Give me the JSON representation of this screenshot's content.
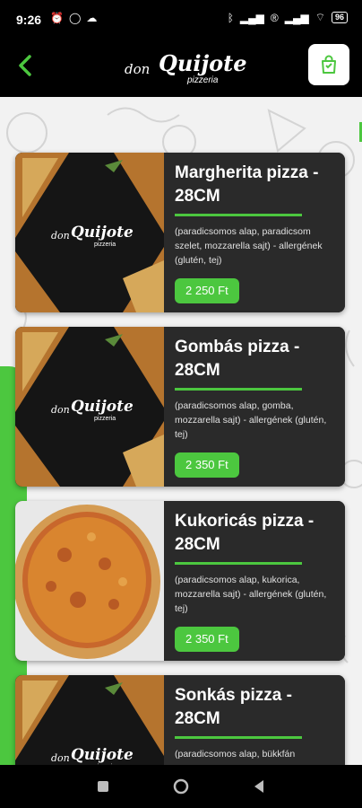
{
  "status_bar": {
    "time": "9:26",
    "battery": "96",
    "left_icons": [
      "alarm-icon",
      "circle-icon",
      "cloud-icon"
    ],
    "right_icons": [
      "bluetooth-icon",
      "signal-icon",
      "registered-icon",
      "signal-icon",
      "wifi-icon",
      "battery-icon"
    ]
  },
  "app_bar": {
    "logo_don": "don",
    "logo_quijote": "Quijote",
    "logo_pizzeria": "pizzeria",
    "back_icon": "chevron-left-icon",
    "cart_icon": "shopping-bag-icon"
  },
  "products": [
    {
      "title": "Margherita pizza - 28CM",
      "description": "(paradicsomos alap, paradicsom szelet, mozzarella sajt) - allergének (glutén, tej)",
      "price": "2 250 Ft",
      "image": "logo-pizza"
    },
    {
      "title": "Gombás pizza - 28CM",
      "description": "(paradicsomos alap, gomba, mozzarella sajt) - allergének (glutén, tej)",
      "price": "2 350 Ft",
      "image": "logo-pizza"
    },
    {
      "title": "Kukoricás pizza - 28CM",
      "description": "(paradicsomos alap, kukorica, mozzarella sajt) - allergének (glutén, tej)",
      "price": "2 350 Ft",
      "image": "photo-pizza"
    },
    {
      "title": "Sonkás pizza - 28CM",
      "description": "(paradicsomos alap, bükkfán",
      "price": "",
      "image": "logo-pizza"
    }
  ],
  "nav_bar": {
    "items": [
      "square-icon",
      "circle-icon",
      "triangle-back-icon"
    ]
  },
  "colors": {
    "accent": "#4cc73f",
    "card_bg": "#2a2a2a",
    "page_bg": "#f2f2f2",
    "bar_bg": "#000000"
  }
}
